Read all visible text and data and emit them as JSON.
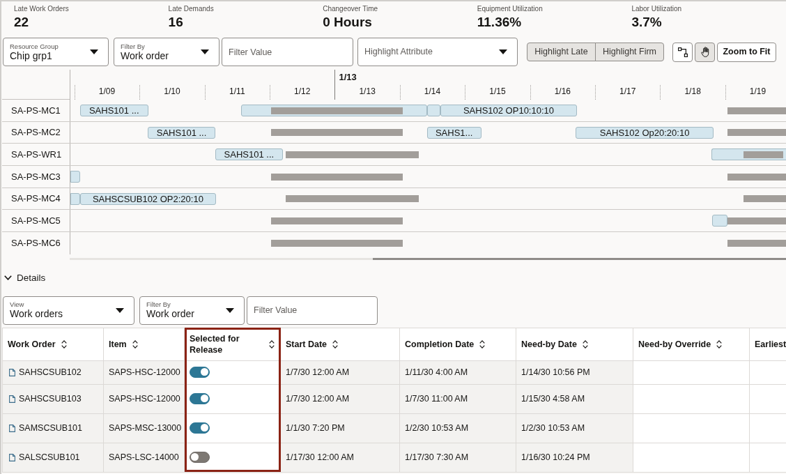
{
  "kpis": [
    {
      "label": "Late Work Orders",
      "value": "22"
    },
    {
      "label": "Late Demands",
      "value": "16"
    },
    {
      "label": "Changeover Time",
      "value": "0 Hours"
    },
    {
      "label": "Equipment Utilization",
      "value": "11.36%"
    },
    {
      "label": "Labor Utilization",
      "value": "3.7%"
    }
  ],
  "toolbar": {
    "resource_group": {
      "label": "Resource Group",
      "value": "Chip grp1"
    },
    "filter_by": {
      "label": "Filter By",
      "value": "Work order"
    },
    "filter_value": {
      "placeholder": "Filter Value"
    },
    "highlight_attribute": {
      "placeholder": "Highlight Attribute"
    },
    "highlight_buttons": [
      "Highlight Late",
      "Highlight Firm"
    ],
    "tools": [
      {
        "kind": "connect",
        "selected": false
      },
      {
        "kind": "pan",
        "selected": true
      }
    ],
    "zoom_button": "Zoom to Fit"
  },
  "gantt": {
    "current_date_label": "1/13",
    "days": [
      {
        "label": "1/09",
        "current": false
      },
      {
        "label": "1/10",
        "current": false
      },
      {
        "label": "1/11",
        "current": false
      },
      {
        "label": "1/12",
        "current": false
      },
      {
        "label": "1/13",
        "current": true
      },
      {
        "label": "1/14",
        "current": false
      },
      {
        "label": "1/15",
        "current": false
      },
      {
        "label": "1/16",
        "current": false
      },
      {
        "label": "1/17",
        "current": false
      },
      {
        "label": "1/18",
        "current": false
      },
      {
        "label": "1/19",
        "current": false
      }
    ],
    "rows": [
      {
        "resource": "SA-PS-MC1",
        "bars": [
          {
            "kind": "task",
            "label": "SAHS101 ..."
          },
          {
            "kind": "task"
          },
          {
            "kind": "non_working"
          },
          {
            "kind": "task"
          },
          {
            "kind": "task",
            "label": "SAHS102 OP10:10:10"
          },
          {
            "kind": "non_working"
          }
        ]
      },
      {
        "resource": "SA-PS-MC2",
        "bars": [
          {
            "kind": "task",
            "label": "SAHS101 ..."
          },
          {
            "kind": "non_working"
          },
          {
            "kind": "task",
            "label": "SAHS1..."
          },
          {
            "kind": "task",
            "label": "SAHS102 Op20:20:10"
          },
          {
            "kind": "non_working"
          }
        ]
      },
      {
        "resource": "SA-PS-WR1",
        "bars": [
          {
            "kind": "task",
            "label": "SAHS101 ..."
          },
          {
            "kind": "non_working"
          },
          {
            "kind": "task"
          },
          {
            "kind": "non_working"
          }
        ]
      },
      {
        "resource": "SA-PS-MC3",
        "bars": [
          {
            "kind": "task"
          },
          {
            "kind": "non_working"
          },
          {
            "kind": "non_working"
          }
        ]
      },
      {
        "resource": "SA-PS-MC4",
        "bars": [
          {
            "kind": "task"
          },
          {
            "kind": "task",
            "label": "SAHSCSUB102 OP2:20:10"
          },
          {
            "kind": "non_working"
          },
          {
            "kind": "non_working"
          }
        ]
      },
      {
        "resource": "SA-PS-MC5",
        "bars": [
          {
            "kind": "non_working"
          },
          {
            "kind": "task"
          },
          {
            "kind": "non_working"
          }
        ]
      },
      {
        "resource": "SA-PS-MC6",
        "bars": [
          {
            "kind": "non_working"
          },
          {
            "kind": "non_working"
          }
        ]
      }
    ]
  },
  "details": {
    "title": "Details",
    "expanded": true,
    "view": {
      "label": "View",
      "value": "Work orders"
    },
    "filter_by": {
      "label": "Filter By",
      "value": "Work order"
    },
    "filter_value": {
      "placeholder": "Filter Value"
    }
  },
  "table": {
    "columns": [
      {
        "label": "Work Order",
        "sortable": true,
        "editable": false,
        "highlighted": false
      },
      {
        "label": "Item",
        "sortable": true,
        "editable": false,
        "highlighted": false
      },
      {
        "label": "Selected for Release",
        "sortable": true,
        "editable": true,
        "highlighted": true
      },
      {
        "label": "Start Date",
        "sortable": true,
        "editable": false,
        "highlighted": false
      },
      {
        "label": "Completion Date",
        "sortable": true,
        "editable": false,
        "highlighted": false
      },
      {
        "label": "Need-by Date",
        "sortable": true,
        "editable": false,
        "highlighted": false
      },
      {
        "label": "Need-by Override",
        "sortable": true,
        "editable": true,
        "highlighted": false
      },
      {
        "label": "Earliest",
        "sortable": false,
        "editable": true,
        "highlighted": false
      }
    ],
    "rows": [
      {
        "work_order": "SAHSCSUB102",
        "item": "SAPS-HSC-12000",
        "selected_for_release": true,
        "start_date": "1/7/30 12:00 AM",
        "completion_date": "1/11/30 4:00 AM",
        "need_by_date": "1/14/30 10:56 PM"
      },
      {
        "work_order": "SAHSCSUB103",
        "item": "SAPS-HSC-12000",
        "selected_for_release": true,
        "start_date": "1/7/30 12:00 AM",
        "completion_date": "1/7/30 11:00 AM",
        "need_by_date": "1/15/30 4:58 AM"
      },
      {
        "work_order": "SAMSCSUB101",
        "item": "SAPS-MSC-13000",
        "selected_for_release": true,
        "start_date": "1/1/30 7:20 PM",
        "completion_date": "1/2/30 10:53 AM",
        "need_by_date": "1/2/30 10:53 AM"
      },
      {
        "work_order": "SALSCSUB101",
        "item": "SAPS-LSC-14000",
        "selected_for_release": false,
        "start_date": "1/17/30 12:00 AM",
        "completion_date": "1/17/30 7:30 AM",
        "need_by_date": "1/16/30 10:24 PM"
      }
    ]
  }
}
